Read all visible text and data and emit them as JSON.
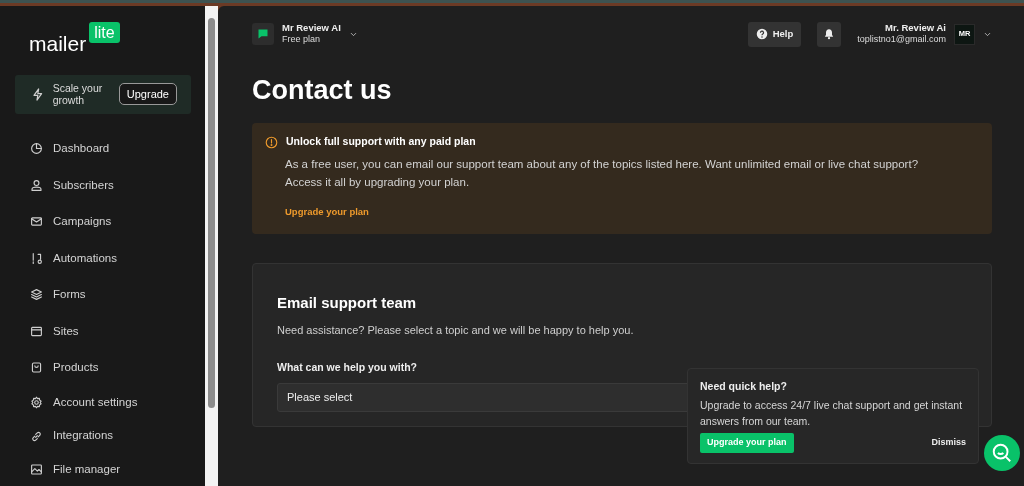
{
  "sidebar": {
    "logo": {
      "word": "mailer",
      "badge": "lite"
    },
    "promo": {
      "text": "Scale your growth",
      "button": "Upgrade"
    },
    "items": [
      {
        "label": "Dashboard"
      },
      {
        "label": "Subscribers"
      },
      {
        "label": "Campaigns"
      },
      {
        "label": "Automations"
      },
      {
        "label": "Forms"
      },
      {
        "label": "Sites"
      },
      {
        "label": "Products"
      },
      {
        "label": "Account settings"
      },
      {
        "label": "Integrations"
      },
      {
        "label": "File manager"
      }
    ]
  },
  "topbar": {
    "account": {
      "name": "Mr Review AI",
      "plan": "Free plan"
    },
    "help": "Help",
    "user": {
      "name": "Mr. Review Ai",
      "email": "toplistno1@gmail.com",
      "avatar": "MR"
    }
  },
  "title": "Contact us",
  "alert": {
    "title": "Unlock full support with any paid plan",
    "body": "As a free user, you can email our support team about any of the topics listed here. Want unlimited email or live chat support? Access it all by upgrading your plan.",
    "link": "Upgrade your plan"
  },
  "support": {
    "title": "Email support team",
    "subtitle": "Need assistance? Please select a topic and we will be happy to help you.",
    "label": "What can we help you with?",
    "select": "Please select"
  },
  "popup": {
    "title": "Need quick help?",
    "body": "Upgrade to access 24/7 live chat support and get instant answers from our team.",
    "button": "Upgrade your plan",
    "dismiss": "Dismiss"
  }
}
